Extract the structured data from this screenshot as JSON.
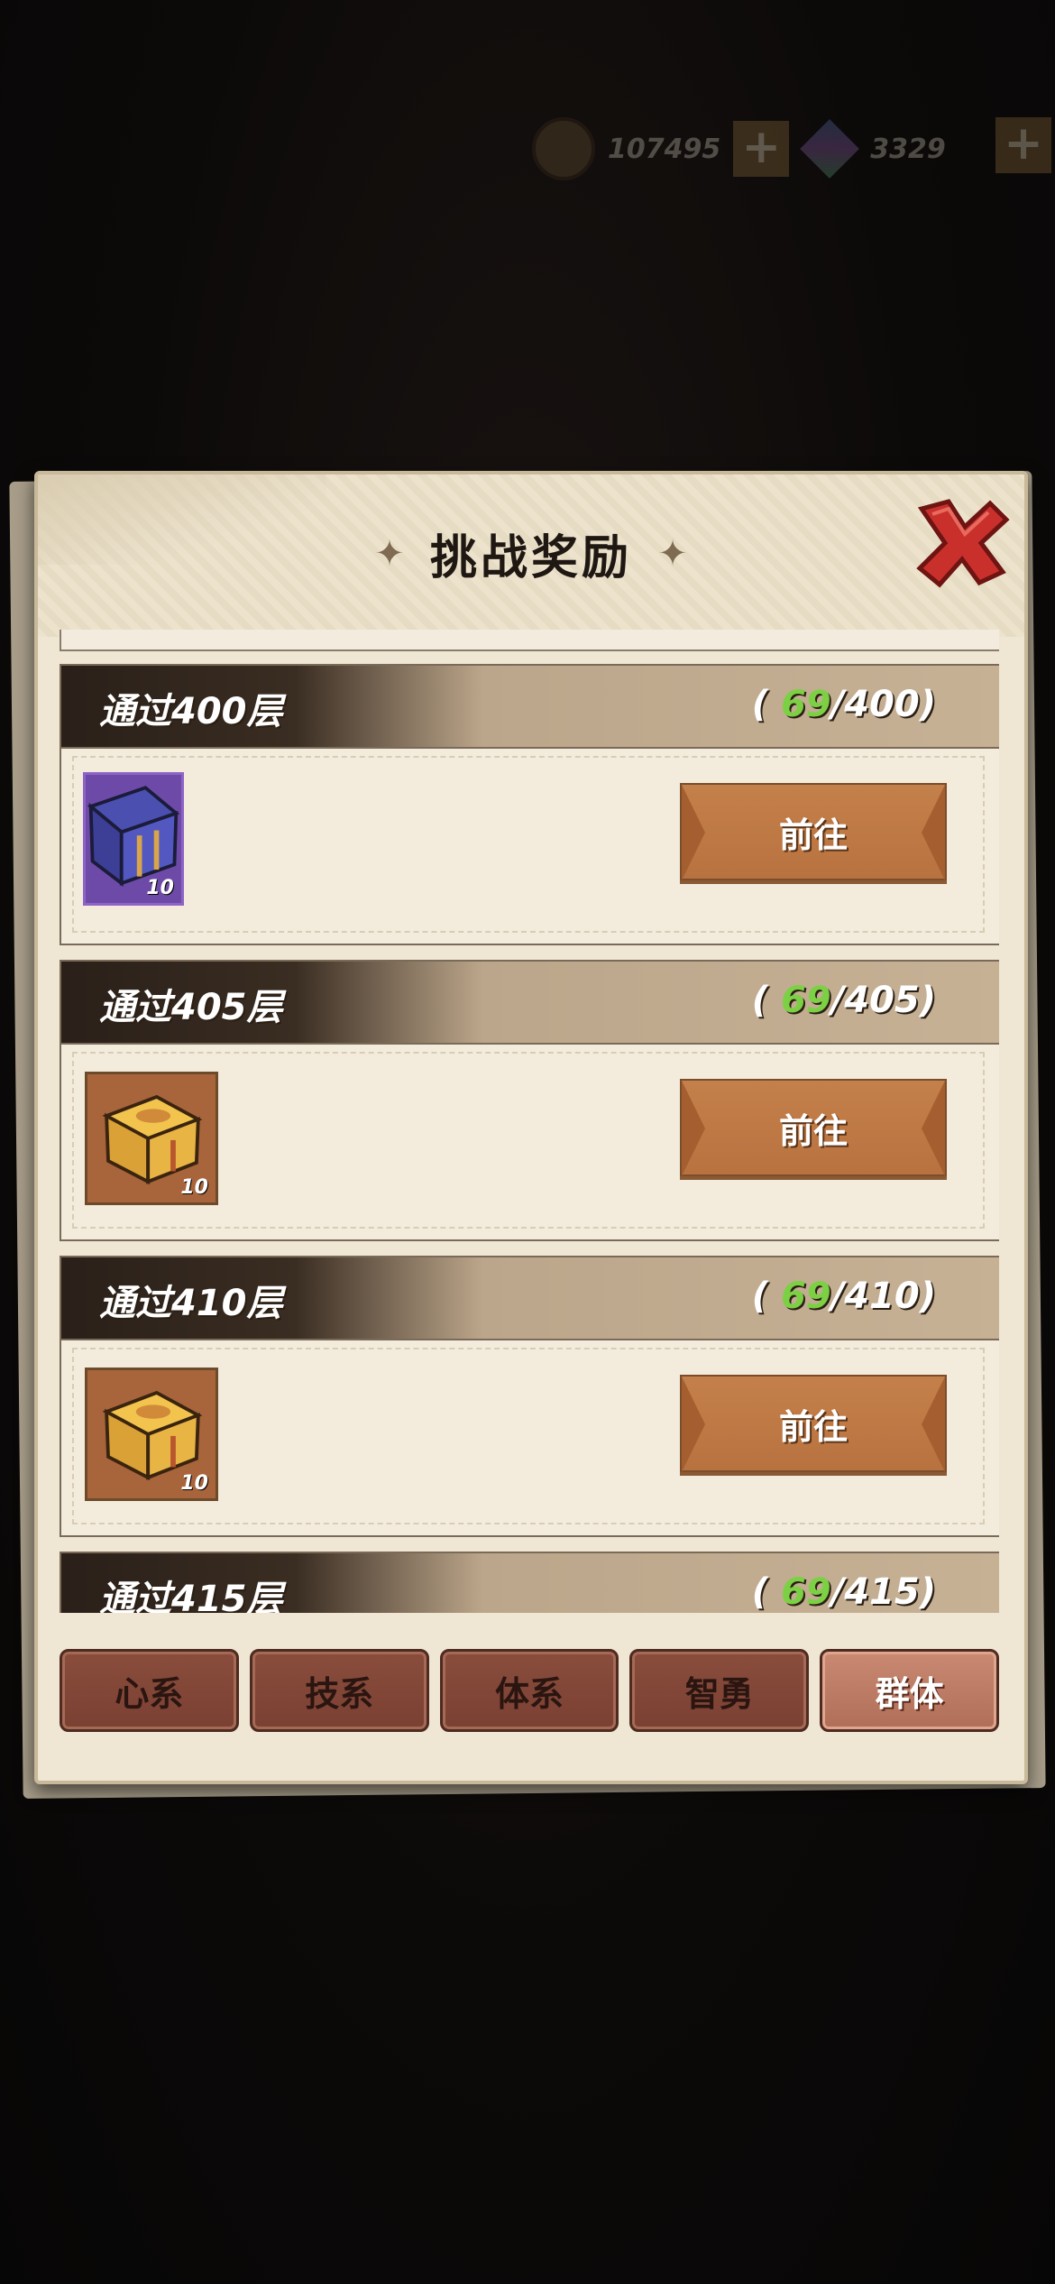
{
  "topbar": {
    "coins": "107495",
    "gems": "3329"
  },
  "modal": {
    "title": "挑战奖励"
  },
  "rewards": [
    {
      "title": "通过400层",
      "progress_current": "69",
      "progress_total": "/400)",
      "progress_open": "(",
      "item": "purple-chest",
      "count": "10",
      "button": "前往"
    },
    {
      "title": "通过405层",
      "progress_current": "69",
      "progress_total": "/405)",
      "progress_open": "(",
      "item": "gold-chest",
      "count": "10",
      "button": "前往"
    },
    {
      "title": "通过410层",
      "progress_current": "69",
      "progress_total": "/410)",
      "progress_open": "(",
      "item": "gold-chest",
      "count": "10",
      "button": "前往"
    },
    {
      "title": "通过415层",
      "progress_current": "69",
      "progress_total": "/415)",
      "progress_open": "("
    }
  ],
  "tabs": [
    {
      "label": "心系"
    },
    {
      "label": "技系"
    },
    {
      "label": "体系"
    },
    {
      "label": "智勇"
    },
    {
      "label": "群体",
      "active": true
    }
  ],
  "colors": {
    "progress_current": "#7bd143",
    "button": "#c4804a",
    "tab_active": "#c98973"
  }
}
